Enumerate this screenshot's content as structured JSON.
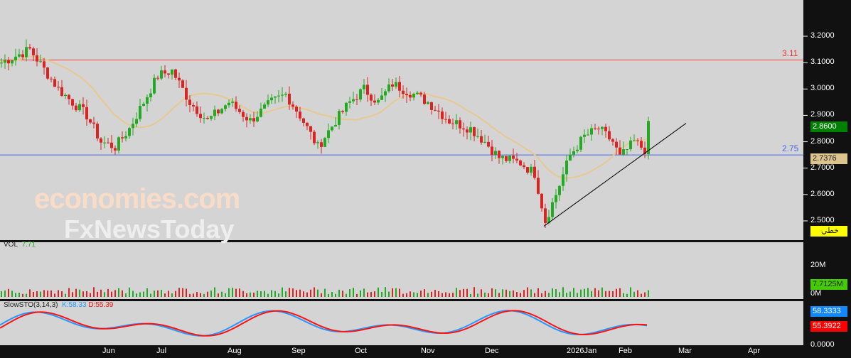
{
  "price_axis": {
    "ticks": [
      "3.2000",
      "3.1000",
      "3.0000",
      "2.9000",
      "2.8000",
      "2.7000",
      "2.6000",
      "2.5000"
    ],
    "min": 2.5,
    "max": 3.2
  },
  "tags": {
    "last_price": "2.8600",
    "ma_value": "2.7376",
    "line_label": "خطي",
    "vol_value": "7.7125M",
    "k_value": "58.3333",
    "d_value": "55.3922"
  },
  "levels": {
    "resistance": "3.11",
    "support": "2.75",
    "resistance_value": 3.11,
    "support_value": 2.75
  },
  "volume": {
    "label": "VOL",
    "value": "7.71",
    "ticks": [
      "20M",
      "0M"
    ]
  },
  "stochastic": {
    "label": "SlowSTO(3,14,3)",
    "k": "K:58.33",
    "d": "D:55.39",
    "tick": "0.0000"
  },
  "months": [
    "Jun",
    "Jul",
    "Aug",
    "Sep",
    "Oct",
    "Nov",
    "Dec",
    "2026Jan",
    "Feb",
    "Mar",
    "Apr"
  ],
  "watermark": {
    "line1": "economies.com",
    "line2": "FxNewsToday"
  },
  "colors": {
    "up": "#22aa22",
    "down": "#dd2222",
    "ma": "#e8c890",
    "k": "#2299ff",
    "d": "#ff1111"
  },
  "chart_data": {
    "type": "candlestick",
    "bars": 182,
    "keypoints": [
      [
        0,
        3.1
      ],
      [
        8,
        3.15
      ],
      [
        16,
        3.0
      ],
      [
        24,
        2.9
      ],
      [
        28,
        2.8
      ],
      [
        32,
        2.78
      ],
      [
        36,
        2.85
      ],
      [
        40,
        2.95
      ],
      [
        44,
        3.05
      ],
      [
        48,
        3.07
      ],
      [
        53,
        2.95
      ],
      [
        58,
        2.88
      ],
      [
        64,
        2.95
      ],
      [
        70,
        2.88
      ],
      [
        76,
        2.95
      ],
      [
        80,
        2.98
      ],
      [
        84,
        2.9
      ],
      [
        89,
        2.78
      ],
      [
        94,
        2.88
      ],
      [
        98,
        2.95
      ],
      [
        102,
        3.0
      ],
      [
        106,
        2.95
      ],
      [
        110,
        3.02
      ],
      [
        116,
        2.98
      ],
      [
        120,
        2.95
      ],
      [
        126,
        2.88
      ],
      [
        132,
        2.85
      ],
      [
        136,
        2.8
      ],
      [
        140,
        2.74
      ],
      [
        146,
        2.72
      ],
      [
        150,
        2.68
      ],
      [
        153,
        2.5
      ],
      [
        156,
        2.6
      ],
      [
        160,
        2.75
      ],
      [
        164,
        2.82
      ],
      [
        168,
        2.85
      ],
      [
        172,
        2.8
      ],
      [
        174,
        2.74
      ],
      [
        178,
        2.8
      ],
      [
        181,
        2.77
      ],
      [
        182,
        2.86
      ]
    ],
    "trendline": [
      [
        153,
        2.48
      ],
      [
        193,
        2.87
      ]
    ]
  }
}
